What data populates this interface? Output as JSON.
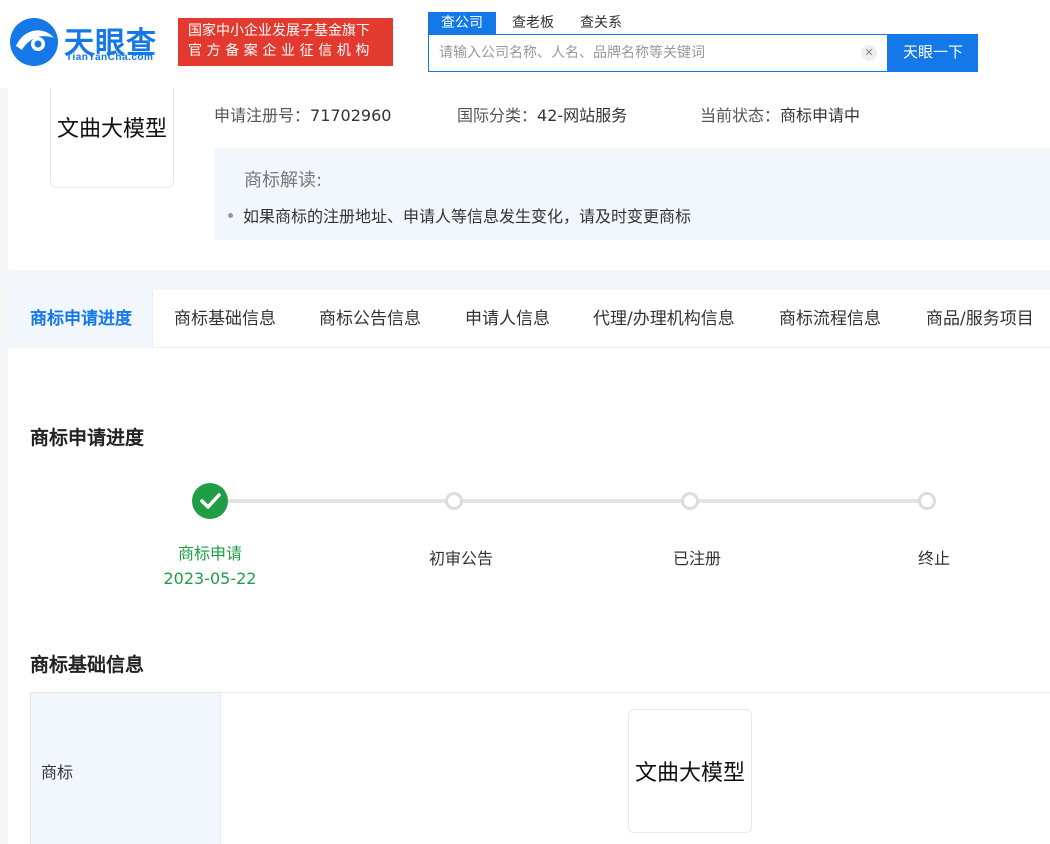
{
  "header": {
    "logo_text": "天眼查",
    "logo_sub": "TianYanCha.com",
    "badge_line1": "国家中小企业发展子基金旗下",
    "badge_line2": "官方备案企业征信机构",
    "search_tabs": [
      "查公司",
      "查老板",
      "查关系"
    ],
    "search_placeholder": "请输入公司名称、人名、品牌名称等关键词",
    "search_button": "天眼一下"
  },
  "trademark": {
    "name": "文曲大模型",
    "reg_no_label": "申请注册号：",
    "reg_no": "71702960",
    "class_label": "国际分类：",
    "class_value": "42-网站服务",
    "status_label": "当前状态：",
    "status_value": "商标申请中",
    "interp_title": "商标解读:",
    "interp_item": "如果商标的注册地址、申请人等信息发生变化，请及时变更商标"
  },
  "tabs": [
    "商标申请进度",
    "商标基础信息",
    "商标公告信息",
    "申请人信息",
    "代理/办理机构信息",
    "商标流程信息",
    "商品/服务项目"
  ],
  "progress": {
    "title": "商标申请进度",
    "steps": [
      {
        "label": "商标申请",
        "date": "2023-05-22",
        "done": true
      },
      {
        "label": "初审公告",
        "done": false
      },
      {
        "label": "已注册",
        "done": false
      },
      {
        "label": "终止",
        "done": false
      }
    ]
  },
  "basic": {
    "title": "商标基础信息",
    "row_label": "商标",
    "row_value": "文曲大模型"
  },
  "colors": {
    "brand": "#1478e8",
    "done": "#1f9e46",
    "badge": "#e23a2f"
  }
}
